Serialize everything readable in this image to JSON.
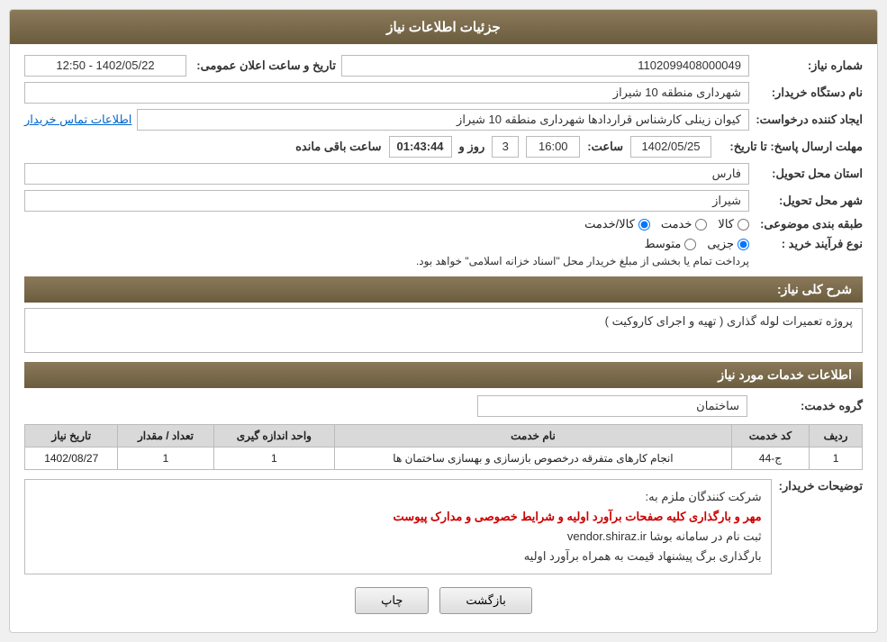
{
  "header": {
    "title": "جزئیات اطلاعات نیاز"
  },
  "fields": {
    "shomara_niaz_label": "شماره نیاز:",
    "shomara_niaz_value": "1102099408000049",
    "nam_dastgah_label": "نام دستگاه خریدار:",
    "nam_dastgah_value": "شهرداری منطقه 10 شیراز",
    "ijad_konande_label": "ایجاد کننده درخواست:",
    "ijad_konande_value": "کیوان زینلی کارشناس قراردادها شهرداری منطقه 10 شیراز",
    "ijad_konande_link": "اطلاعات تماس خریدار",
    "mohlat_label": "مهلت ارسال پاسخ: تا تاریخ:",
    "mohlat_date": "1402/05/25",
    "mohlat_saat_label": "ساعت:",
    "mohlat_saat": "16:00",
    "mohlat_roz_label": "روز و",
    "mohlat_roz": "3",
    "mohlat_countdown_label": "ساعت باقی مانده",
    "mohlat_countdown": "01:43:44",
    "tarikh_label": "تاریخ و ساعت اعلان عمومی:",
    "tarikh_value": "1402/05/22 - 12:50",
    "ostan_label": "استان محل تحویل:",
    "ostan_value": "فارس",
    "shahr_label": "شهر محل تحویل:",
    "shahr_value": "شیراز",
    "tabaqe_label": "طبقه بندی موضوعی:",
    "radio_kala": "کالا",
    "radio_khadamat": "خدمت",
    "radio_kala_khadamat": "کالا/خدمت",
    "noye_farayand_label": "نوع فرآیند خرید :",
    "radio_jozi": "جزیی",
    "radio_motawaset": "متوسط",
    "radio_text": "پرداخت تمام یا بخشی از مبلغ خریدار محل \"اسناد خزانه اسلامی\" خواهد بود.",
    "sharh_label": "شرح کلی نیاز:",
    "sharh_value": "پروژه تعمیرات لوله گذاری ( تهیه و اجرای کاروکیت )",
    "ettelaat_header": "اطلاعات خدمات مورد نیاز",
    "gorohe_khadamat_label": "گروه خدمت:",
    "gorohe_khadamat_value": "ساختمان",
    "table": {
      "headers": [
        "ردیف",
        "کد خدمت",
        "نام خدمت",
        "واحد اندازه گیری",
        "تعداد / مقدار",
        "تاریخ نیاز"
      ],
      "rows": [
        {
          "radif": "1",
          "kod": "ج-44",
          "nam": "انجام کارهای متفرقه درخصوص بازسازی و بهسازی ساختمان ها",
          "vahed": "1",
          "tedad": "1",
          "tarikh": "1402/08/27"
        }
      ]
    },
    "tozihat_label": "توضیحات خریدار:",
    "tozihat_line1": "شرکت کنندگان ملزم به:",
    "tozihat_line2": "مهر و بارگذاری کلیه صفحات برآورد اولیه و شرایط خصوصی و مدارک پیوست",
    "tozihat_line3": "ثبت نام در سامانه بوشا vendor.shiraz.ir",
    "tozihat_line4": "بارگذاری برگ پیشنهاد قیمت به همراه برآورد اولیه",
    "tozihat_highlight": "مهر و بارگذاری کلیه صفحات برآورد اولیه و شرایط خصوصی و مدارک پیوست"
  },
  "buttons": {
    "chap": "چاپ",
    "bazgasht": "بازگشت"
  }
}
